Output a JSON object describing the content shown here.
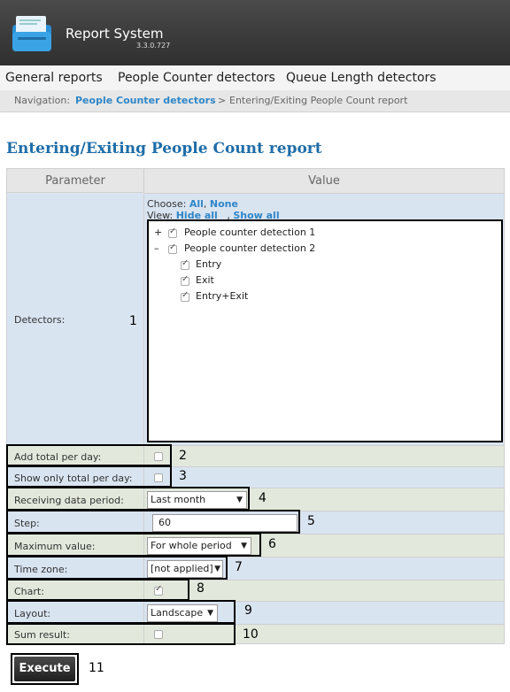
{
  "app": {
    "title": "Report System",
    "version": "3.3.0.727"
  },
  "menu": {
    "items": [
      {
        "label": "General reports"
      },
      {
        "label": "People Counter detectors"
      },
      {
        "label": "Queue Length detectors"
      }
    ]
  },
  "nav": {
    "prefix": "Navigation:",
    "link": "People Counter detectors",
    "separator": ">",
    "current": "Entering/Exiting People Count report"
  },
  "page": {
    "title": "Entering/Exiting People Count report"
  },
  "table": {
    "header_parameter": "Parameter",
    "header_value": "Value",
    "detectors": {
      "label": "Detectors:",
      "choose_label": "Choose:",
      "choose_all": "All",
      "choose_comma": ",",
      "choose_none": "None",
      "view_label": "View:",
      "view_hide": "Hide all",
      "view_comma": ",",
      "view_show": "Show all",
      "tree": [
        {
          "toggle": "+",
          "label": "People counter detection 1",
          "checked": true
        },
        {
          "toggle": "–",
          "label": "People counter detection 2",
          "checked": true,
          "children": [
            {
              "label": "Entry",
              "checked": true
            },
            {
              "label": "Exit",
              "checked": true
            },
            {
              "label": "Entry+Exit",
              "checked": true
            }
          ]
        }
      ]
    },
    "rows": {
      "add_total": {
        "label": "Add total per day:",
        "checked": false
      },
      "show_total": {
        "label": "Show only total per day:",
        "checked": false
      },
      "period": {
        "label": "Receiving data period:",
        "value": "Last month"
      },
      "step": {
        "label": "Step:",
        "value": "60"
      },
      "max_value": {
        "label": "Maximum value:",
        "value": "For whole period"
      },
      "time_zone": {
        "label": "Time zone:",
        "value": "[not applied]"
      },
      "chart": {
        "label": "Chart:",
        "checked": true
      },
      "layout": {
        "label": "Layout:",
        "value": "Landscape"
      },
      "sum_result": {
        "label": "Sum result:",
        "checked": false
      }
    }
  },
  "execute_label": "Execute",
  "callouts": [
    "1",
    "2",
    "3",
    "4",
    "5",
    "6",
    "7",
    "8",
    "9",
    "10",
    "11"
  ]
}
